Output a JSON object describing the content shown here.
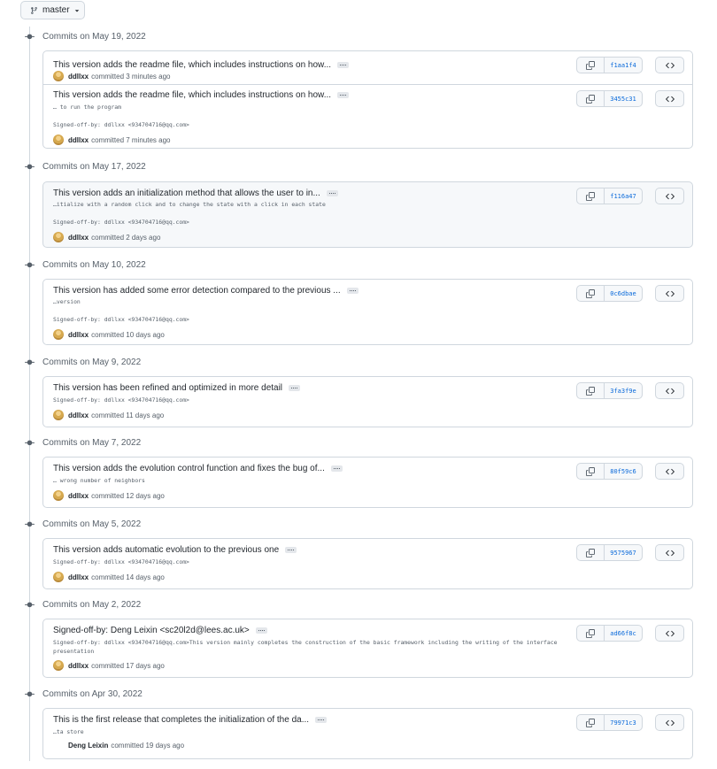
{
  "branch": {
    "name": "master"
  },
  "groups": [
    {
      "date": "Commits on May 19, 2022",
      "commits": [
        {
          "title": "This version adds the readme file, which includes instructions on how...",
          "body": "",
          "author": "ddllxx",
          "time": "committed 3 minutes ago",
          "sha": "f1aa1f4"
        },
        {
          "title": "This version adds the readme file, which includes instructions on how...",
          "body": "… to run the program\n\nSigned-off-by: ddllxx <934704716@qq.com>",
          "author": "ddllxx",
          "time": "committed 7 minutes ago",
          "sha": "3455c31"
        }
      ]
    },
    {
      "date": "Commits on May 17, 2022",
      "commits": [
        {
          "title": "This version adds an initialization method that allows the user to in...",
          "body": "…itialize with a random click and to change the state with a click in each state\n\nSigned-off-by: ddllxx <934704716@qq.com>",
          "author": "ddllxx",
          "time": "committed 2 days ago",
          "sha": "f116a47"
        }
      ]
    },
    {
      "date": "Commits on May 10, 2022",
      "commits": [
        {
          "title": "This version has added some error detection compared to the previous ...",
          "body": "…version\n\nSigned-off-by: ddllxx <934704716@qq.com>",
          "author": "ddllxx",
          "time": "committed 10 days ago",
          "sha": "0c6dbae"
        }
      ]
    },
    {
      "date": "Commits on May 9, 2022",
      "commits": [
        {
          "title": "This version has been refined and optimized in more detail",
          "body": "Signed-off-by: ddllxx <934704716@qq.com>",
          "author": "ddllxx",
          "time": "committed 11 days ago",
          "sha": "3fa3f9e"
        }
      ]
    },
    {
      "date": "Commits on May 7, 2022",
      "commits": [
        {
          "title": "This version adds the evolution control function and fixes the bug of...",
          "body": "… wrong number of neighbors",
          "author": "ddllxx",
          "time": "committed 12 days ago",
          "sha": "80f59c6"
        }
      ]
    },
    {
      "date": "Commits on May 5, 2022",
      "commits": [
        {
          "title": "This version adds automatic evolution to the previous one",
          "body": "Signed-off-by: ddllxx <934704716@qq.com>",
          "author": "ddllxx",
          "time": "committed 14 days ago",
          "sha": "9575967"
        }
      ]
    },
    {
      "date": "Commits on May 2, 2022",
      "commits": [
        {
          "title": "Signed-off-by: Deng Leixin <sc20l2d@lees.ac.uk>",
          "body": "Signed-off-by: ddllxx <934704716@qq.com>This version mainly completes the construction of the basic framework including the writing of the interface presentation",
          "author": "ddllxx",
          "time": "committed 17 days ago",
          "sha": "ad66f8c"
        }
      ]
    },
    {
      "date": "Commits on Apr 30, 2022",
      "commits": [
        {
          "title": "This is the first release that completes the initialization of the da...",
          "body": "…ta store",
          "author": "Deng Leixin",
          "time": "committed 19 days ago",
          "sha": "79971c3"
        }
      ]
    }
  ]
}
